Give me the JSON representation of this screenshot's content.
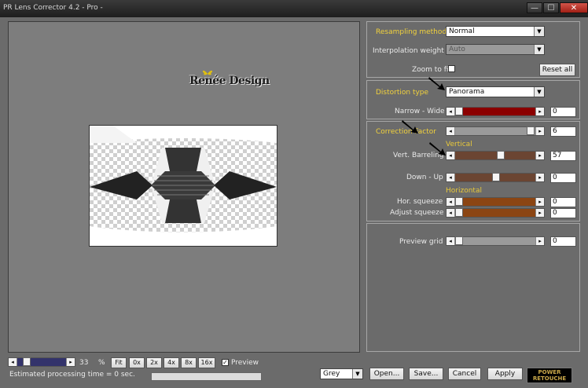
{
  "window": {
    "title": "PR Lens Corrector 4.2 - Pro -",
    "min": "—",
    "max": "☐",
    "close": "✕"
  },
  "preview": {
    "logo_text": "Renée Design"
  },
  "resampling": {
    "method_label": "Resampling method",
    "method_value": "Normal",
    "interp_label": "Interpolation weight",
    "interp_value": "Auto",
    "zoom_label": "Zoom to fit",
    "reset_label": "Reset all"
  },
  "distortion": {
    "type_label": "Distortion type",
    "type_value": "Panorama",
    "narrow_label": "Narrow - Wide",
    "narrow_value": "0"
  },
  "correction": {
    "factor_label": "Correction Factor",
    "factor_value": "6",
    "vertical_heading": "Vertical",
    "vbarrel_label": "Vert. Barreling",
    "vbarrel_value": "57",
    "downup_label": "Down - Up",
    "downup_value": "0",
    "horizontal_heading": "Horizontal",
    "hsqueeze_label": "Hor. squeeze",
    "hsqueeze_value": "0",
    "adjsqueeze_label": "Adjust squeeze",
    "adjsqueeze_value": "0"
  },
  "grid": {
    "label": "Preview grid",
    "value": "0"
  },
  "zoom": {
    "value": "33",
    "unit": "%",
    "fit": "Fit",
    "z0": "0x",
    "z2": "2x",
    "z4": "4x",
    "z8": "8x",
    "z16": "16x",
    "preview_label": "Preview"
  },
  "status": {
    "estimate": "Estimated processing time =  0 sec."
  },
  "footer": {
    "bg_value": "Grey",
    "open": "Open...",
    "save": "Save...",
    "cancel": "Cancel",
    "apply": "Apply",
    "brand_line1": "POWER",
    "brand_line2": "RETOUCHE"
  },
  "colors": {
    "slider_red": "#8b0000",
    "slider_brown": "#6b4532",
    "slider_orange": "#8b4513",
    "label_yellow": "#f2d23c"
  }
}
